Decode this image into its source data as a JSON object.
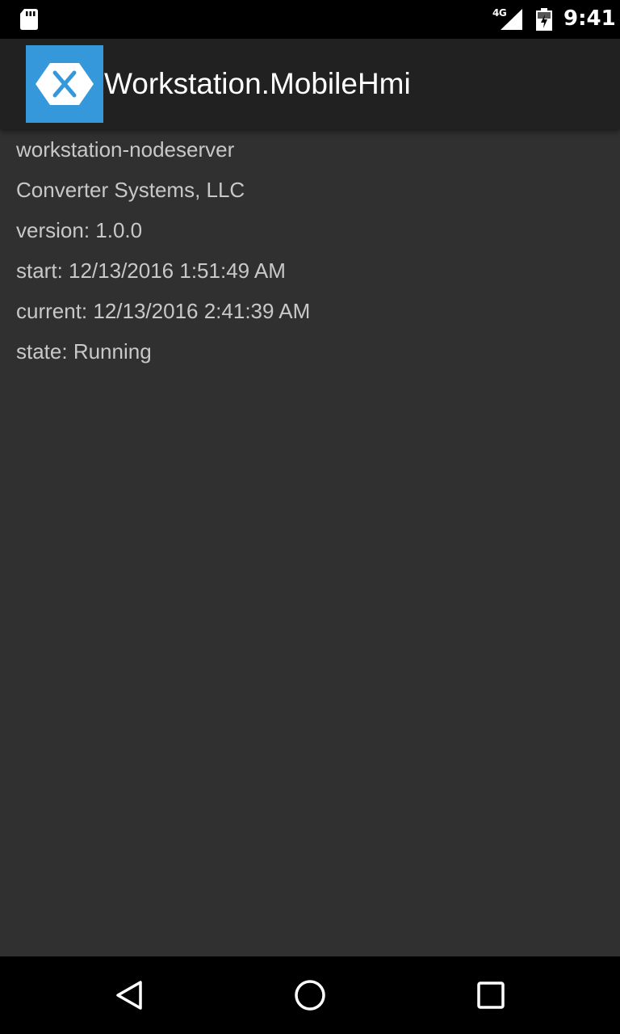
{
  "status_bar": {
    "network_type": "4G",
    "time": "9:41",
    "icons": [
      "sd-card-icon",
      "signal-icon",
      "battery-icon"
    ]
  },
  "app_bar": {
    "title": "Workstation.MobileHmi",
    "logo": "xamarin-logo-icon",
    "logo_color": "#3498db"
  },
  "info": {
    "lines": [
      "workstation-nodeserver",
      "Converter Systems, LLC",
      "version: 1.0.0",
      "start: 12/13/2016 1:51:49 AM",
      "current: 12/13/2016 2:41:39 AM",
      "state: Running"
    ]
  },
  "nav_bar": {
    "buttons": [
      "back-icon",
      "home-icon",
      "recents-icon"
    ]
  },
  "colors": {
    "background": "#303030",
    "app_bar": "#212121",
    "text": "#c8c8c8",
    "system_bars": "#000000"
  }
}
